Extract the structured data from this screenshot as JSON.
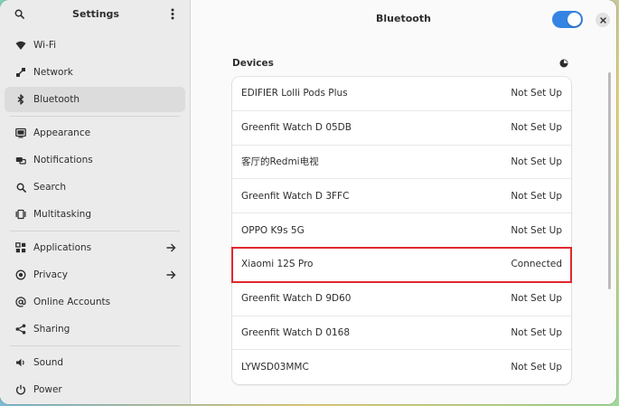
{
  "sidebar": {
    "title": "Settings",
    "items": [
      {
        "label": "Wi-Fi",
        "icon": "wifi-icon"
      },
      {
        "label": "Network",
        "icon": "network-icon"
      },
      {
        "label": "Bluetooth",
        "icon": "bluetooth-icon",
        "active": true
      },
      {
        "label": "Appearance",
        "icon": "appearance-icon"
      },
      {
        "label": "Notifications",
        "icon": "notifications-icon"
      },
      {
        "label": "Search",
        "icon": "search-icon"
      },
      {
        "label": "Multitasking",
        "icon": "multitasking-icon"
      },
      {
        "label": "Applications",
        "icon": "applications-icon",
        "arrow": true
      },
      {
        "label": "Privacy",
        "icon": "privacy-icon",
        "arrow": true
      },
      {
        "label": "Online Accounts",
        "icon": "online-accounts-icon"
      },
      {
        "label": "Sharing",
        "icon": "sharing-icon"
      },
      {
        "label": "Sound",
        "icon": "sound-icon"
      },
      {
        "label": "Power",
        "icon": "power-icon"
      }
    ]
  },
  "main": {
    "title": "Bluetooth",
    "bluetooth_enabled": true,
    "devices_title": "Devices",
    "devices": [
      {
        "name": "EDIFIER Lolli Pods Plus",
        "status": "Not Set Up"
      },
      {
        "name": "Greenfit Watch D 05DB",
        "status": "Not Set Up"
      },
      {
        "name": "客厅的Redmi电视",
        "status": "Not Set Up"
      },
      {
        "name": "Greenfit Watch D 3FFC",
        "status": "Not Set Up"
      },
      {
        "name": "OPPO K9s 5G",
        "status": "Not Set Up"
      },
      {
        "name": "Xiaomi 12S Pro",
        "status": "Connected",
        "highlighted": true
      },
      {
        "name": "Greenfit Watch D 9D60",
        "status": "Not Set Up"
      },
      {
        "name": "Greenfit Watch D 0168",
        "status": "Not Set Up"
      },
      {
        "name": "LYWSD03MMC",
        "status": "Not Set Up"
      }
    ]
  },
  "colors": {
    "accent": "#3584e4",
    "highlight": "#e0282e"
  }
}
